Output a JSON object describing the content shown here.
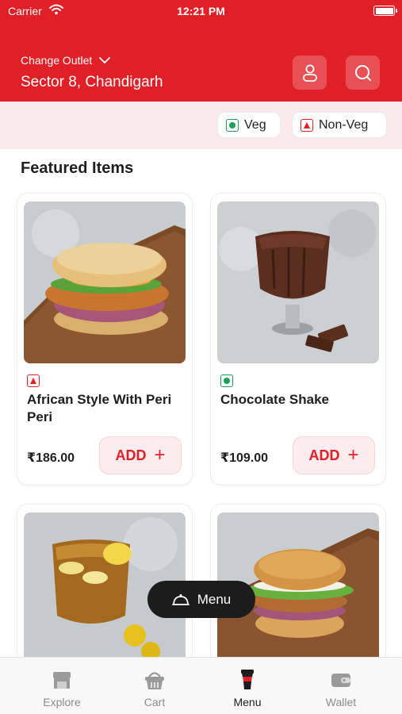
{
  "status_bar": {
    "carrier": "Carrier",
    "time": "12:21 PM"
  },
  "header": {
    "change_outlet_label": "Change Outlet",
    "outlet_name": "Sector 8, Chandigarh",
    "brand_color": "#e11f26",
    "profile_icon": "user-icon",
    "search_icon": "search-icon"
  },
  "filters": {
    "veg": "Veg",
    "non_veg": "Non-Veg"
  },
  "featured": {
    "title": "Featured Items",
    "items": [
      {
        "name": "African Style With Peri Peri",
        "price": "₹186.00",
        "type": "non-veg",
        "add": "ADD"
      },
      {
        "name": "Chocolate Shake",
        "price": "₹109.00",
        "type": "veg",
        "add": "ADD"
      },
      {
        "name": "",
        "price": "",
        "type": "",
        "add": ""
      },
      {
        "name": "",
        "price": "",
        "type": "",
        "add": ""
      }
    ]
  },
  "menu_button": {
    "label": "Menu"
  },
  "bottom_nav": [
    {
      "label": "Explore",
      "icon": "store-icon",
      "active": false
    },
    {
      "label": "Cart",
      "icon": "basket-icon",
      "active": false
    },
    {
      "label": "Menu",
      "icon": "coffee-cup-icon",
      "active": true
    },
    {
      "label": "Wallet",
      "icon": "wallet-icon",
      "active": false
    }
  ]
}
